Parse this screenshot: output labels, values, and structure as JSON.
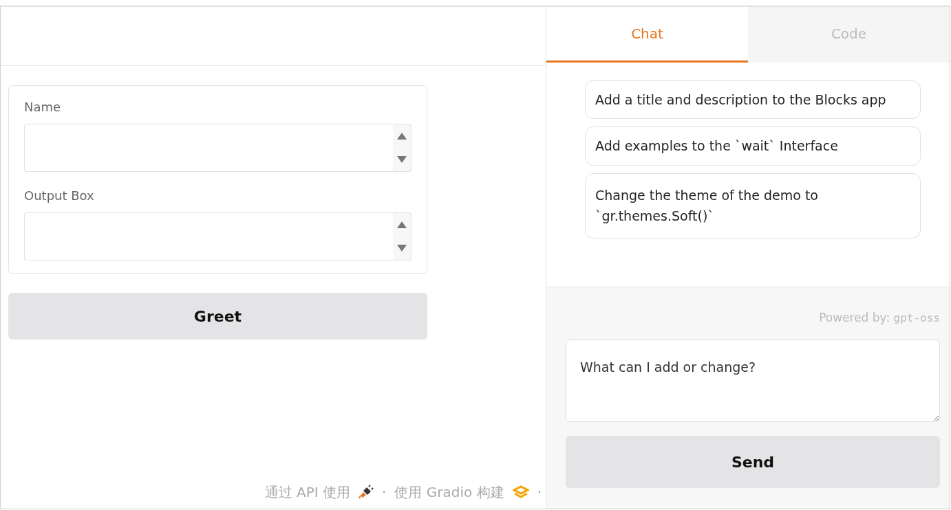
{
  "form": {
    "fields": [
      {
        "label": "Name"
      },
      {
        "label": "Output Box"
      }
    ],
    "button": "Greet"
  },
  "footer": {
    "api_link": "通过 API 使用",
    "separator": "·",
    "built_with": "使用 Gradio 构建",
    "trailing_separator": "·"
  },
  "tabs": [
    {
      "label": "Chat",
      "selected": true
    },
    {
      "label": "Code",
      "selected": false
    }
  ],
  "chat": {
    "suggestions": [
      "Add a title and description to the Blocks app",
      "Add examples to the `wait` Interface",
      "Change the theme of the demo to `gr.themes.Soft()`"
    ],
    "powered_label": "Powered by:",
    "powered_model": "gpt-oss",
    "input": {
      "value": "What can I add or change?"
    },
    "send_button": "Send"
  }
}
